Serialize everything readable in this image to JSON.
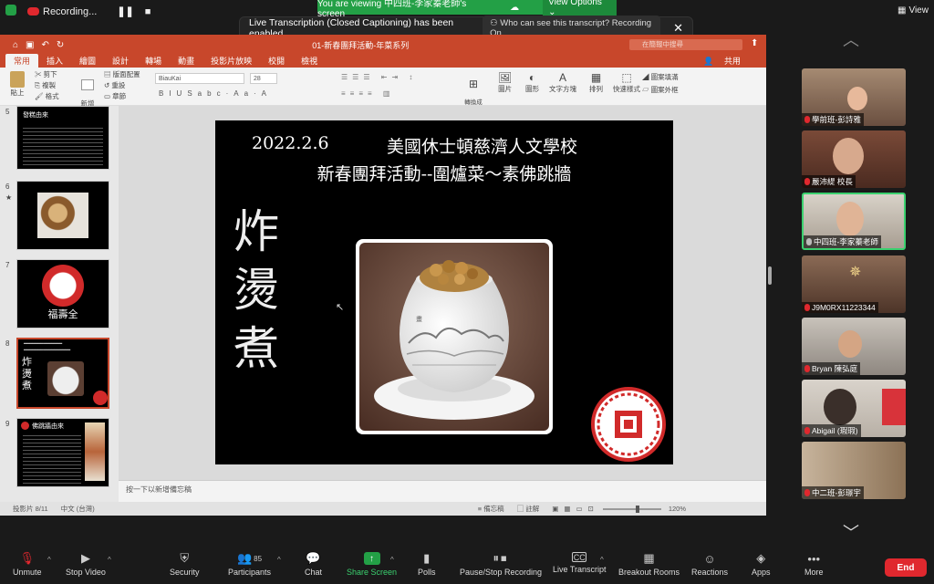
{
  "zoom_top": {
    "recording_label": "Recording...",
    "viewing_text": "You are viewing 中四班-李家蓁老師's screen",
    "view_options": "View Options ⌄",
    "view_button": "View",
    "toast_text": "Live Transcription (Closed Captioning) has been enabled",
    "toast_button": "Who can see this transcript? Recording On"
  },
  "ppt": {
    "filename": "01-新春團拜活動-年菜系列",
    "search_placeholder": "在簡報中搜尋",
    "share_label": "共用",
    "tabs": [
      "常用",
      "插入",
      "繪圖",
      "設計",
      "轉場",
      "動畫",
      "投影片放映",
      "校閱",
      "檢視"
    ],
    "ribbon": {
      "paste": "貼上",
      "cut": "剪下",
      "copy": "複製",
      "format": "格式",
      "new_slide": "新增\n投影片",
      "layout": "版面配置",
      "reset": "重設",
      "section": "章節",
      "font_name": "BiauKai",
      "font_size": "28",
      "convert": "轉換成\nSmartArt",
      "picture": "圖片",
      "shapes": "圖形",
      "textbox": "文字方塊",
      "arrange": "排列",
      "quick_styles": "快速樣式",
      "fill": "圖案填滿",
      "outline": "圖案外框"
    },
    "thumbs": [
      {
        "num": "5",
        "label": "發糕由來"
      },
      {
        "num": "6"
      },
      {
        "num": "7",
        "label": "福壽全"
      },
      {
        "num": "8",
        "vert": "炸\n燙\n煮"
      },
      {
        "num": "9",
        "label": "佛跳牆由來"
      }
    ],
    "slide": {
      "date": "2022.2.6",
      "school": "美國休士頓慈濟人文學校",
      "subtitle": "新春團拜活動--圍爐菜～素佛跳牆",
      "vertical": "炸\n燙\n煮"
    },
    "notes_placeholder": "按一下以新增備忘稿",
    "status": {
      "slide_count": "投影片 8/11",
      "language": "中文 (台灣)",
      "notes": "備忘稿",
      "comments": "註解",
      "zoom": "120%"
    }
  },
  "participants_tiles": [
    {
      "name": "學前班-彭詩雅",
      "bg": "#8a6a55"
    },
    {
      "name": "嚴沛緹 校長",
      "bg": "#6b3b2e"
    },
    {
      "name": "中四班-李家蓁老師",
      "bg": "#c9c2b6",
      "active": true
    },
    {
      "name": "J9M0RX11223344",
      "bg": "#7a5b49"
    },
    {
      "name": "Bryan 陳弘庭",
      "bg": "#b9b3ab"
    },
    {
      "name": "Abigail (瑕瑕)",
      "bg": "#cfc8be"
    },
    {
      "name": "中二班-彭璟宇",
      "bg": "#a08870"
    }
  ],
  "toolbar": {
    "unmute": "Unmute",
    "stop_video": "Stop Video",
    "security": "Security",
    "participants": "Participants",
    "participants_count": "85",
    "chat": "Chat",
    "share_screen": "Share Screen",
    "polls": "Polls",
    "pause_stop_recording": "Pause/Stop Recording",
    "live_transcript": "Live Transcript",
    "breakout_rooms": "Breakout Rooms",
    "reactions": "Reactions",
    "apps": "Apps",
    "more": "More",
    "end": "End"
  },
  "colors": {
    "ppt_accent": "#c8472b",
    "share_green": "#23a046",
    "end_red": "#e0282e"
  }
}
